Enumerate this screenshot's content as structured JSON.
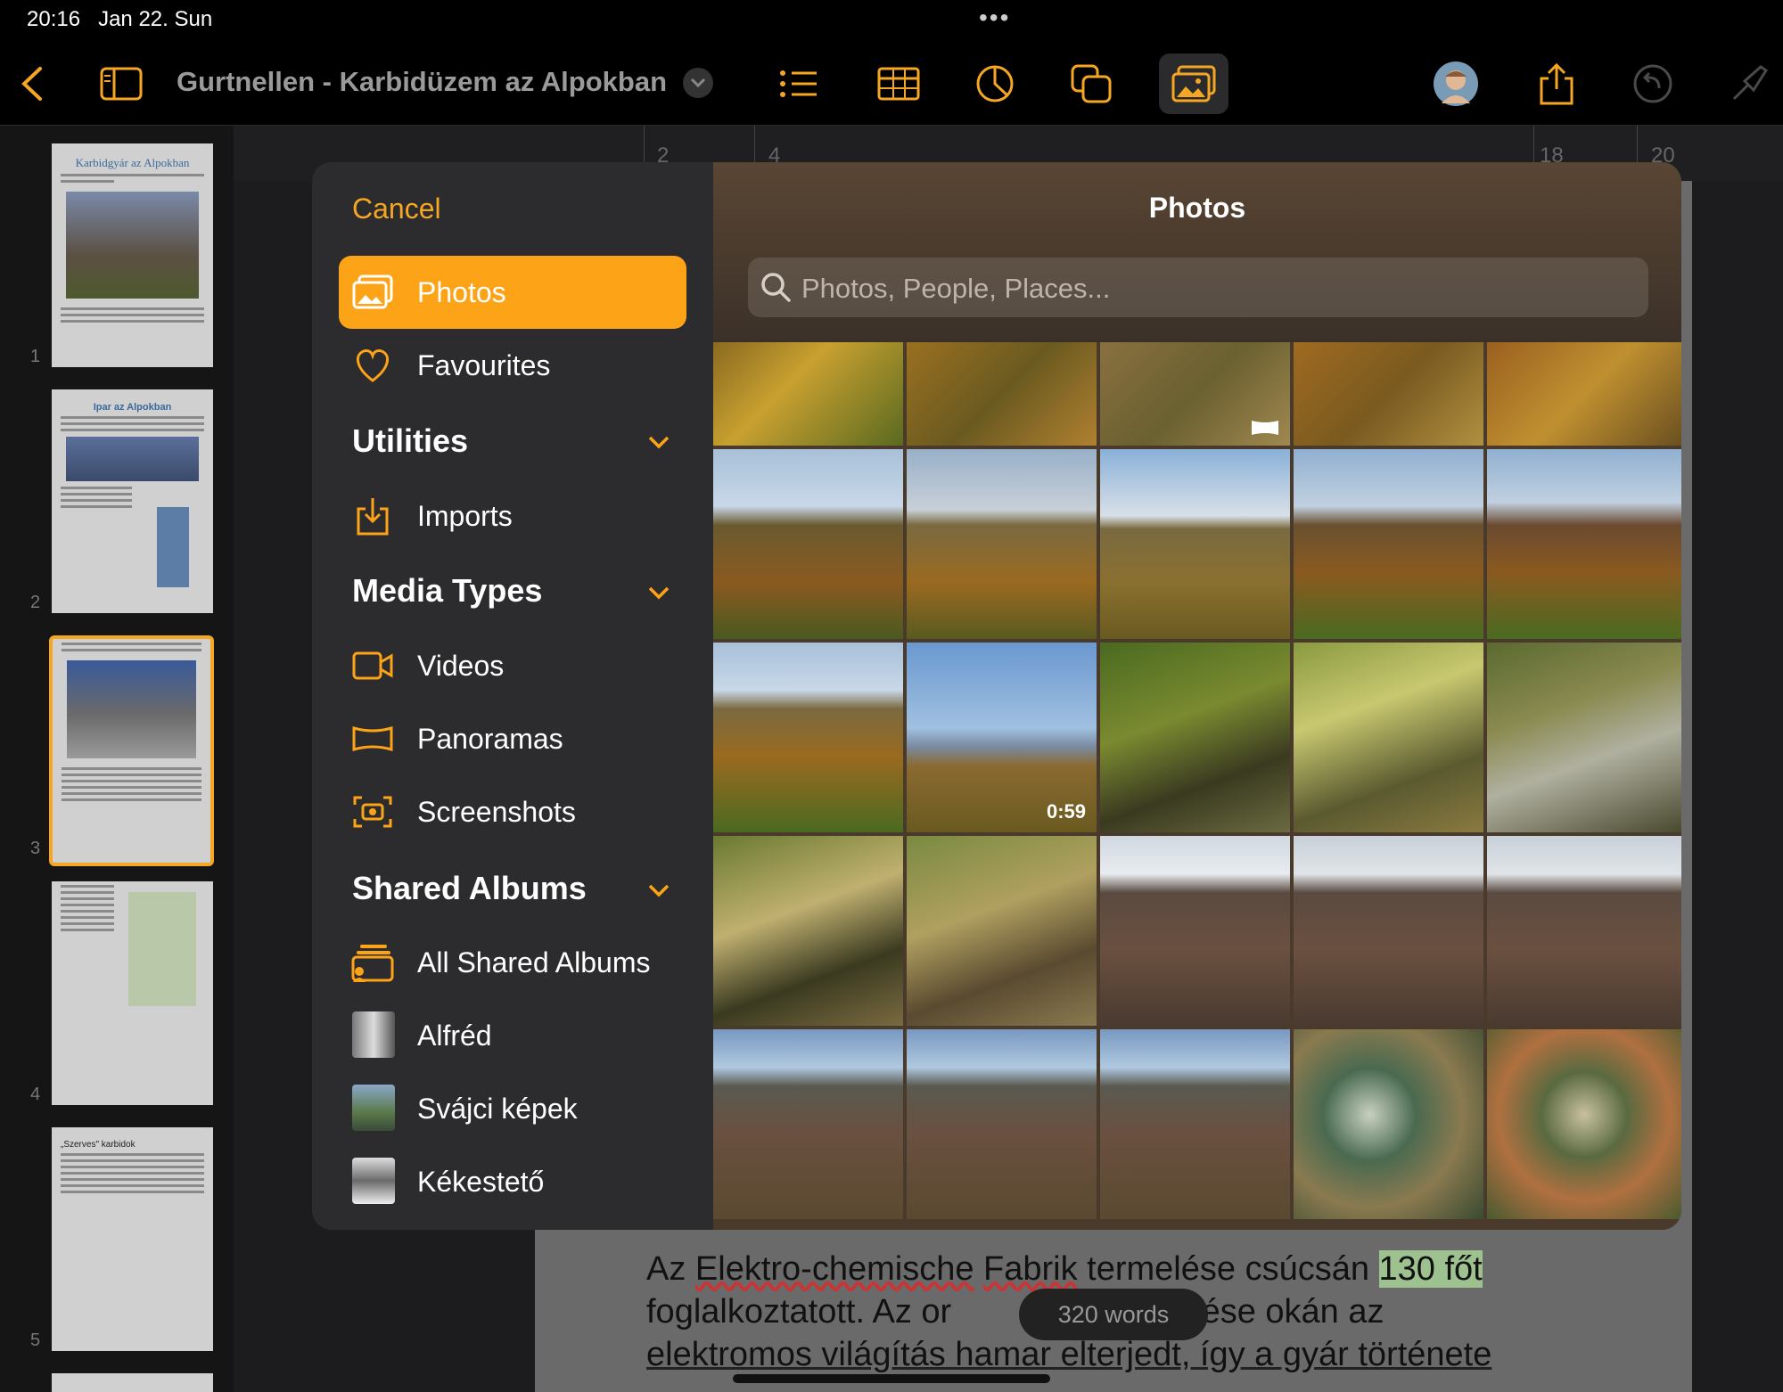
{
  "status": {
    "time": "20:16",
    "date": "Jan 22. Sun",
    "dots": "•••"
  },
  "toolbar": {
    "title": "Gurtnellen - Karbidüzem az Alpokban"
  },
  "ruler": {
    "ticks": [
      "2",
      "4",
      "18",
      "20"
    ]
  },
  "thumbnails": [
    {
      "number": "1",
      "heading": "Karbidgyár az Alpokban"
    },
    {
      "number": "2",
      "heading": "Ipar az Alpokban"
    },
    {
      "number": "3",
      "heading": ""
    },
    {
      "number": "4",
      "heading": ""
    },
    {
      "number": "5",
      "heading": "„Szerves\" karbidok"
    }
  ],
  "picker": {
    "cancel": "Cancel",
    "title": "Photos",
    "search_placeholder": "Photos, People, Places...",
    "items": {
      "photos": "Photos",
      "favourites": "Favourites",
      "imports": "Imports",
      "videos": "Videos",
      "panoramas": "Panoramas",
      "screenshots": "Screenshots",
      "all_shared": "All Shared Albums",
      "alfred": "Alfréd",
      "svajci": "Svájci képek",
      "kekesteto": "Kékestető"
    },
    "sections": {
      "utilities": "Utilities",
      "media_types": "Media Types",
      "shared_albums": "Shared Albums"
    },
    "video_duration": "0:59"
  },
  "document": {
    "line1_a": "Az ",
    "line1_b": "Elektro-chemische",
    "line1_c": " ",
    "line1_d": "Fabrik",
    "line1_e": " termelése csúcsán ",
    "line1_f": "130 főt",
    "line2_a": "foglalkoztatott. Az or",
    "line2_b": "s fejlődése okán az",
    "line3": "elektromos világítás hamar elterjedt, így a gyár története"
  },
  "word_count": "320 words",
  "colors": {
    "accent": "#fda318",
    "popover_bg": "#2c2c2e"
  }
}
